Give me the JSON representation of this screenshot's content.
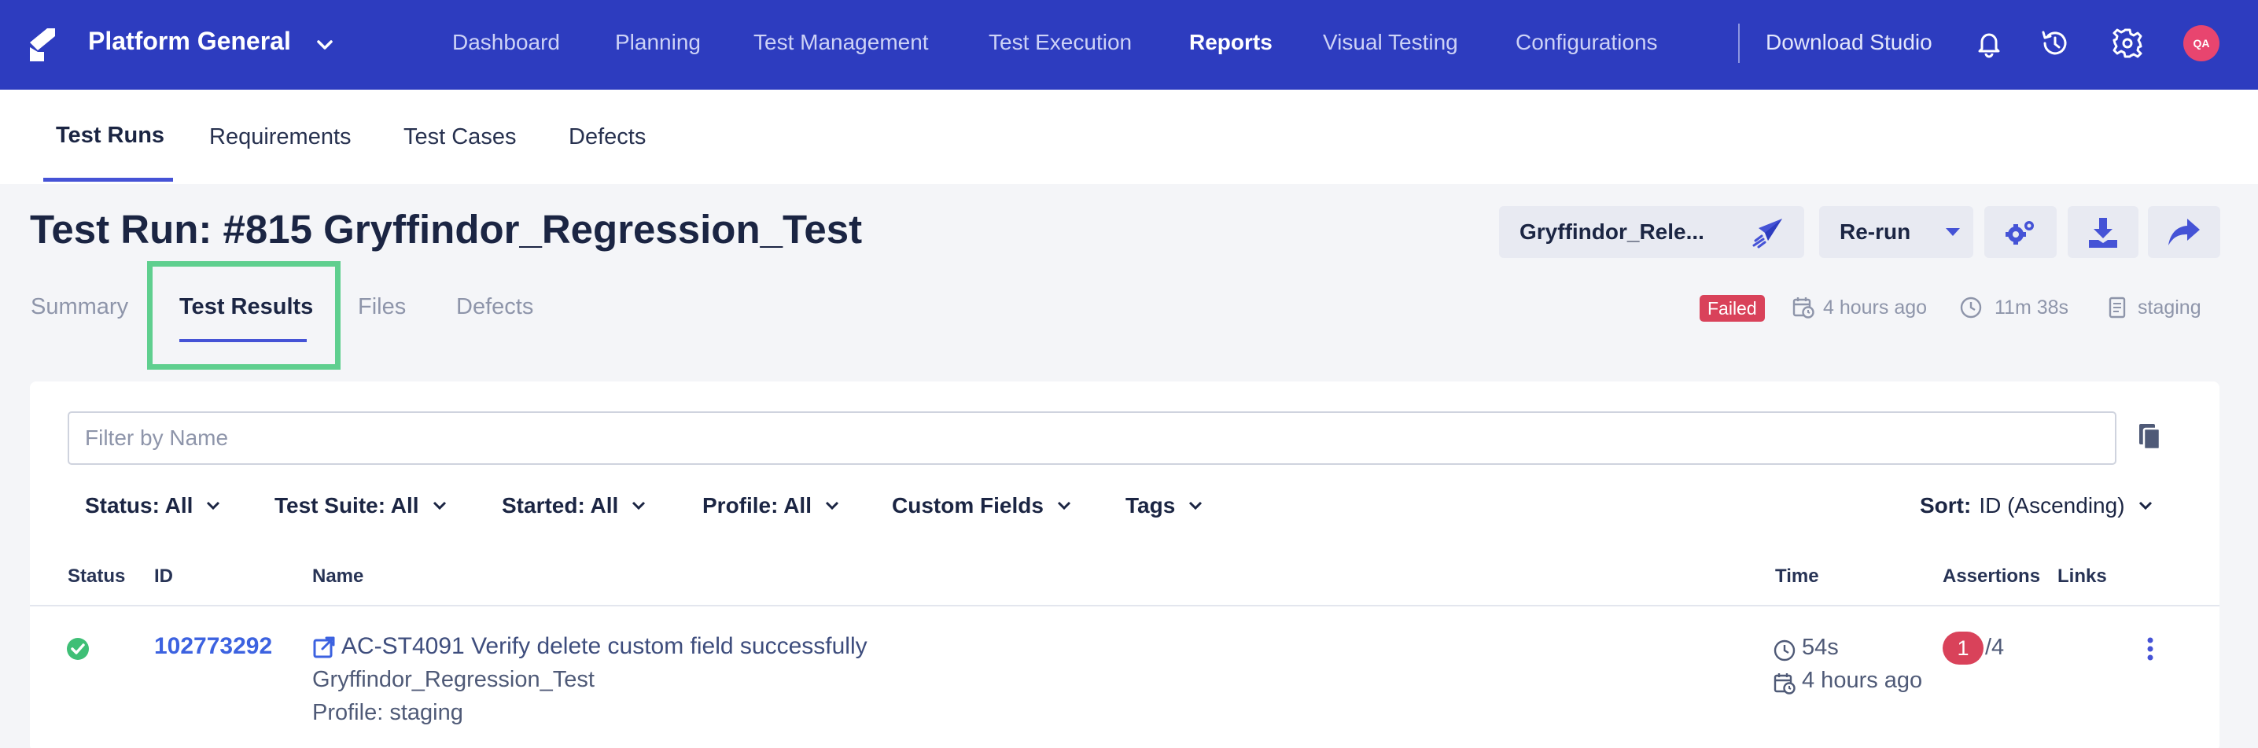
{
  "topbar": {
    "project": "Platform General",
    "nav": [
      "Dashboard",
      "Planning",
      "Test Management",
      "Test Execution",
      "Reports",
      "Visual Testing",
      "Configurations"
    ],
    "active_nav": "Reports",
    "download": "Download Studio",
    "avatar": "QA",
    "brand_color": "#2d3cbf"
  },
  "subnav": {
    "items": [
      "Test Runs",
      "Requirements",
      "Test Cases",
      "Defects"
    ],
    "active": "Test Runs"
  },
  "page": {
    "title": "Test Run: #815 Gryffindor_Regression_Test",
    "release_button": "Gryffindor_Rele...",
    "rerun_button": "Re-run"
  },
  "tabs": {
    "items": [
      "Summary",
      "Test Results",
      "Files",
      "Defects"
    ],
    "active": "Test Results"
  },
  "run_meta": {
    "status": "Failed",
    "started": "4 hours ago",
    "duration": "11m 38s",
    "profile": "staging"
  },
  "filters": {
    "placeholder": "Filter by Name",
    "status": "Status: All",
    "suite": "Test Suite: All",
    "started": "Started: All",
    "profile": "Profile: All",
    "custom": "Custom Fields",
    "tags": "Tags",
    "sort_label": "Sort:",
    "sort_value": "ID (Ascending)"
  },
  "table": {
    "columns": [
      "Status",
      "ID",
      "Name",
      "Time",
      "Assertions",
      "Links"
    ],
    "rows": [
      {
        "status": "passed",
        "id": "102773292",
        "name": "AC-ST4091 Verify delete custom field successfully",
        "suite": "Gryffindor_Regression_Test",
        "profile": "Profile: staging",
        "duration": "54s",
        "started": "4 hours ago",
        "assertions_failed": "1",
        "assertions_total": "/4"
      }
    ]
  },
  "colors": {
    "accent": "#4553d6",
    "link": "#3c62e0",
    "failed": "#d9425a",
    "passed": "#3fbf76",
    "highlight": "#5fcf8f"
  }
}
